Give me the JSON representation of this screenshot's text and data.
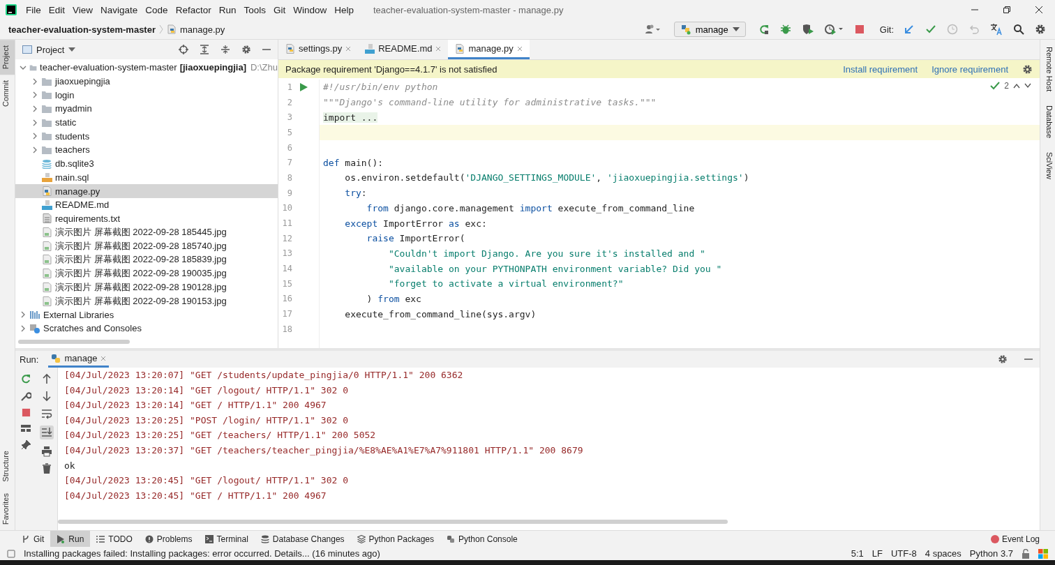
{
  "window": {
    "title": "teacher-evaluation-system-master - manage.py"
  },
  "menu": [
    "File",
    "Edit",
    "View",
    "Navigate",
    "Code",
    "Refactor",
    "Run",
    "Tools",
    "Git",
    "Window",
    "Help"
  ],
  "breadcrumb": [
    {
      "label": "teacher-evaluation-system-master",
      "kind": "project"
    },
    {
      "label": "manage.py",
      "kind": "py"
    }
  ],
  "toolbar": {
    "run_config": "manage",
    "git_label": "Git:"
  },
  "left_strip": [
    {
      "label": "Project",
      "selected": true
    },
    {
      "label": "Commit",
      "selected": false
    },
    {
      "label": "Structure",
      "selected": false
    },
    {
      "label": "Favorites",
      "selected": false
    }
  ],
  "right_strip": [
    {
      "label": "Remote Host"
    },
    {
      "label": "Database"
    },
    {
      "label": "SciView"
    }
  ],
  "project": {
    "title": "Project",
    "tree": [
      {
        "label": "teacher-evaluation-system-master",
        "module": "[jiaoxuepingjia]",
        "path": "D:\\Zhu",
        "kind": "folder",
        "expanded": true,
        "selected": false,
        "children": [
          {
            "label": "jiaoxuepingjia",
            "kind": "folder",
            "expanded": false,
            "selected": false
          },
          {
            "label": "login",
            "kind": "folder",
            "expanded": false,
            "selected": false
          },
          {
            "label": "myadmin",
            "kind": "folder",
            "expanded": false,
            "selected": false
          },
          {
            "label": "static",
            "kind": "folder",
            "expanded": false,
            "selected": false
          },
          {
            "label": "students",
            "kind": "folder",
            "expanded": false,
            "selected": false
          },
          {
            "label": "teachers",
            "kind": "folder",
            "expanded": false,
            "selected": false
          },
          {
            "label": "db.sqlite3",
            "kind": "db",
            "selected": false
          },
          {
            "label": "main.sql",
            "kind": "sql",
            "selected": false
          },
          {
            "label": "manage.py",
            "kind": "py",
            "selected": true
          },
          {
            "label": "README.md",
            "kind": "md",
            "selected": false
          },
          {
            "label": "requirements.txt",
            "kind": "txt",
            "selected": false
          },
          {
            "label": "演示图片 屏幕截图 2022-09-28 185445.jpg",
            "kind": "image",
            "selected": false
          },
          {
            "label": "演示图片 屏幕截图 2022-09-28 185740.jpg",
            "kind": "image",
            "selected": false
          },
          {
            "label": "演示图片 屏幕截图 2022-09-28 185839.jpg",
            "kind": "image",
            "selected": false
          },
          {
            "label": "演示图片 屏幕截图 2022-09-28 190035.jpg",
            "kind": "image",
            "selected": false
          },
          {
            "label": "演示图片 屏幕截图 2022-09-28 190128.jpg",
            "kind": "image",
            "selected": false
          },
          {
            "label": "演示图片 屏幕截图 2022-09-28 190153.jpg",
            "kind": "image",
            "selected": false
          }
        ]
      },
      {
        "label": "External Libraries",
        "kind": "libraries",
        "expanded": false,
        "selected": false
      },
      {
        "label": "Scratches and Consoles",
        "kind": "scratches",
        "expanded": false,
        "selected": false
      }
    ]
  },
  "editor_tabs": [
    {
      "label": "settings.py",
      "kind": "py",
      "selected": false
    },
    {
      "label": "README.md",
      "kind": "md",
      "selected": false
    },
    {
      "label": "manage.py",
      "kind": "py",
      "selected": true
    }
  ],
  "banner": {
    "message": "Package requirement 'Django==4.1.7' is not satisfied",
    "actions": [
      "Install requirement",
      "Ignore requirement"
    ]
  },
  "inspections": {
    "count": "2"
  },
  "code": [
    {
      "number": "1",
      "current": false,
      "runnable": true,
      "tokens": [
        {
          "kind": "comment",
          "text": "#!/usr/bin/env python"
        }
      ]
    },
    {
      "number": "2",
      "current": false,
      "runnable": false,
      "tokens": [
        {
          "kind": "comment",
          "text": "\"\"\"Django's command-line utility for administrative tasks.\"\"\""
        }
      ]
    },
    {
      "number": "3",
      "current": false,
      "runnable": false,
      "tokens": [
        {
          "kind": "folded",
          "text": "import ..."
        }
      ]
    },
    {
      "number": "5",
      "current": true,
      "runnable": false
    },
    {
      "number": "6",
      "current": false,
      "runnable": false
    },
    {
      "number": "7",
      "current": false,
      "runnable": false,
      "tokens": [
        {
          "kind": "kw",
          "text": "def"
        },
        {
          "kind": "plain",
          "text": " main():"
        }
      ]
    },
    {
      "number": "8",
      "current": false,
      "runnable": false,
      "tokens": [
        {
          "kind": "plain",
          "text": "    os.environ.setdefault("
        },
        {
          "kind": "str",
          "text": "'DJANGO_SETTINGS_MODULE'"
        },
        {
          "kind": "plain",
          "text": ", "
        },
        {
          "kind": "str",
          "text": "'jiaoxuepingjia.settings'"
        },
        {
          "kind": "plain",
          "text": ")"
        }
      ]
    },
    {
      "number": "9",
      "current": false,
      "runnable": false,
      "tokens": [
        {
          "kind": "kw",
          "text": "    try"
        },
        {
          "kind": "plain",
          "text": ":"
        }
      ]
    },
    {
      "number": "10",
      "current": false,
      "runnable": false,
      "tokens": [
        {
          "kind": "kw",
          "text": "        from"
        },
        {
          "kind": "plain",
          "text": " django.core.management "
        },
        {
          "kind": "kw",
          "text": "import"
        },
        {
          "kind": "plain",
          "text": " execute_from_command_line"
        }
      ]
    },
    {
      "number": "11",
      "current": false,
      "runnable": false,
      "tokens": [
        {
          "kind": "kw",
          "text": "    except"
        },
        {
          "kind": "plain",
          "text": " ImportError "
        },
        {
          "kind": "kw",
          "text": "as"
        },
        {
          "kind": "plain",
          "text": " exc:"
        }
      ]
    },
    {
      "number": "12",
      "current": false,
      "runnable": false,
      "tokens": [
        {
          "kind": "kw",
          "text": "        raise"
        },
        {
          "kind": "plain",
          "text": " ImportError("
        }
      ]
    },
    {
      "number": "13",
      "current": false,
      "runnable": false,
      "tokens": [
        {
          "kind": "str",
          "text": "            \"Couldn't import Django. Are you sure it's installed and \""
        }
      ]
    },
    {
      "number": "14",
      "current": false,
      "runnable": false,
      "tokens": [
        {
          "kind": "str",
          "text": "            \"available on your PYTHONPATH environment variable? Did you \""
        }
      ]
    },
    {
      "number": "15",
      "current": false,
      "runnable": false,
      "tokens": [
        {
          "kind": "str",
          "text": "            \"forget to activate a virtual environment?\""
        }
      ]
    },
    {
      "number": "16",
      "current": false,
      "runnable": false,
      "tokens": [
        {
          "kind": "plain",
          "text": "        ) "
        },
        {
          "kind": "kw",
          "text": "from"
        },
        {
          "kind": "plain",
          "text": " exc"
        }
      ]
    },
    {
      "number": "17",
      "current": false,
      "runnable": false,
      "tokens": [
        {
          "kind": "plain",
          "text": "    execute_from_command_line(sys.argv)"
        }
      ]
    },
    {
      "number": "18",
      "current": false,
      "runnable": false
    }
  ],
  "run": {
    "title": "Run:",
    "tab": "manage",
    "output": [
      {
        "kind": "log",
        "text": "[04/Jul/2023 13:20:07] \"GET /students/update_pingjia/0 HTTP/1.1\" 200 6362"
      },
      {
        "kind": "log",
        "text": "[04/Jul/2023 13:20:14] \"GET /logout/ HTTP/1.1\" 302 0"
      },
      {
        "kind": "log",
        "text": "[04/Jul/2023 13:20:14] \"GET / HTTP/1.1\" 200 4967"
      },
      {
        "kind": "log",
        "text": "[04/Jul/2023 13:20:25] \"POST /login/ HTTP/1.1\" 302 0"
      },
      {
        "kind": "log",
        "text": "[04/Jul/2023 13:20:25] \"GET /teachers/ HTTP/1.1\" 200 5052"
      },
      {
        "kind": "log",
        "text": "[04/Jul/2023 13:20:37] \"GET /teachers/teacher_pingjia/%E8%AE%A1%E7%A7%911801 HTTP/1.1\" 200 8679"
      },
      {
        "kind": "stdout",
        "text": "ok"
      },
      {
        "kind": "log",
        "text": "[04/Jul/2023 13:20:45] \"GET /logout/ HTTP/1.1\" 302 0"
      },
      {
        "kind": "log",
        "text": "[04/Jul/2023 13:20:45] \"GET / HTTP/1.1\" 200 4967"
      }
    ]
  },
  "bottom_tabs": [
    {
      "label": "Git",
      "kind": "git",
      "selected": false
    },
    {
      "label": "Run",
      "kind": "run",
      "selected": true
    },
    {
      "label": "TODO",
      "kind": "todo",
      "selected": false
    },
    {
      "label": "Problems",
      "kind": "problems",
      "selected": false
    },
    {
      "label": "Terminal",
      "kind": "terminal",
      "selected": false
    },
    {
      "label": "Database Changes",
      "kind": "db",
      "selected": false
    },
    {
      "label": "Python Packages",
      "kind": "packages",
      "selected": false
    },
    {
      "label": "Python Console",
      "kind": "console",
      "selected": false
    }
  ],
  "event_log": "Event Log",
  "status_bar": {
    "message": "Installing packages failed: Installing packages: error occurred. Details... (16 minutes ago)",
    "items": [
      "5:1",
      "LF",
      "UTF-8",
      "4 spaces",
      "Python 3.7"
    ]
  }
}
